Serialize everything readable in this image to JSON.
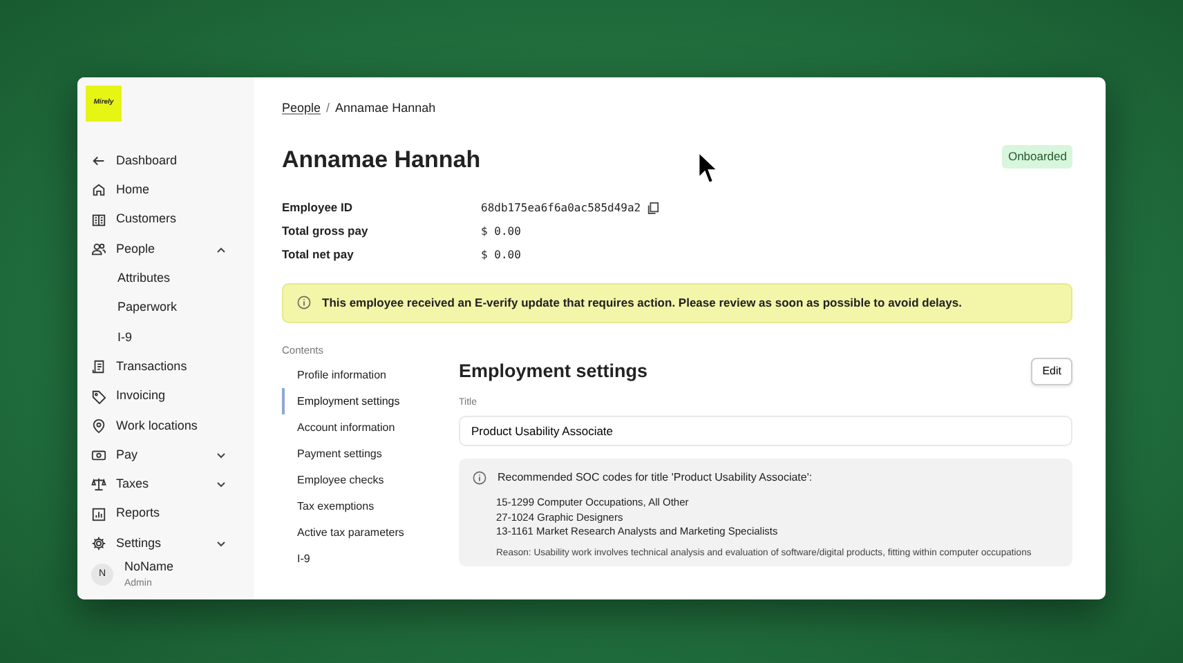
{
  "logo": {
    "text": "Mirely"
  },
  "sidebar": {
    "items": [
      {
        "kind": "back",
        "label": "Dashboard"
      },
      {
        "kind": "item",
        "label": "Home"
      },
      {
        "kind": "item",
        "label": "Customers"
      },
      {
        "kind": "group",
        "label": "People",
        "expanded": true,
        "children": [
          {
            "label": "Attributes"
          },
          {
            "label": "Paperwork"
          },
          {
            "label": "I-9"
          }
        ]
      },
      {
        "kind": "item",
        "label": "Transactions"
      },
      {
        "kind": "item",
        "label": "Invoicing"
      },
      {
        "kind": "item",
        "label": "Work locations"
      },
      {
        "kind": "group",
        "label": "Pay",
        "expanded": false
      },
      {
        "kind": "group",
        "label": "Taxes",
        "expanded": false
      },
      {
        "kind": "item",
        "label": "Reports"
      },
      {
        "kind": "group",
        "label": "Settings",
        "expanded": false
      }
    ],
    "user": {
      "initial": "N",
      "name": "NoName",
      "role": "Admin"
    }
  },
  "breadcrumb": {
    "separator": "/",
    "items": [
      "People",
      "Annamae Hannah"
    ]
  },
  "title": "Annamae Hannah",
  "status_badge": "Onboarded",
  "fields": [
    {
      "label": "Employee ID",
      "value": "68db175ea6f6a0ac585d49a2",
      "copyable": true
    },
    {
      "label": "Total gross pay",
      "value": "$ 0.00",
      "copyable": false
    },
    {
      "label": "Total net pay",
      "value": "$ 0.00",
      "copyable": false
    }
  ],
  "alert": "This employee received an E-verify update that requires action. Please review as soon as possible to avoid delays.",
  "contents": {
    "heading": "Contents",
    "items": [
      {
        "label": "Profile information",
        "selected": false
      },
      {
        "label": "Employment settings",
        "selected": true
      },
      {
        "label": "Account information",
        "selected": false
      },
      {
        "label": "Payment settings",
        "selected": false
      },
      {
        "label": "Employee checks",
        "selected": false
      },
      {
        "label": "Tax exemptions",
        "selected": false
      },
      {
        "label": "Active tax parameters",
        "selected": false
      },
      {
        "label": "I-9",
        "selected": false
      }
    ]
  },
  "section": {
    "title": "Employment settings",
    "edit_button": "Edit",
    "field_label": "Title",
    "field_value": "Product Usability Associate",
    "soc": {
      "heading": "Recommended SOC codes for title 'Product Usability Associate':",
      "codes": [
        "15-1299 Computer Occupations, All Other",
        "27-1024 Graphic Designers",
        "13-1161 Market Research Analysts and Marketing Specialists"
      ],
      "reason": "Reason: Usability work involves technical analysis and evaluation of software/digital products, fitting within computer occupations"
    }
  }
}
